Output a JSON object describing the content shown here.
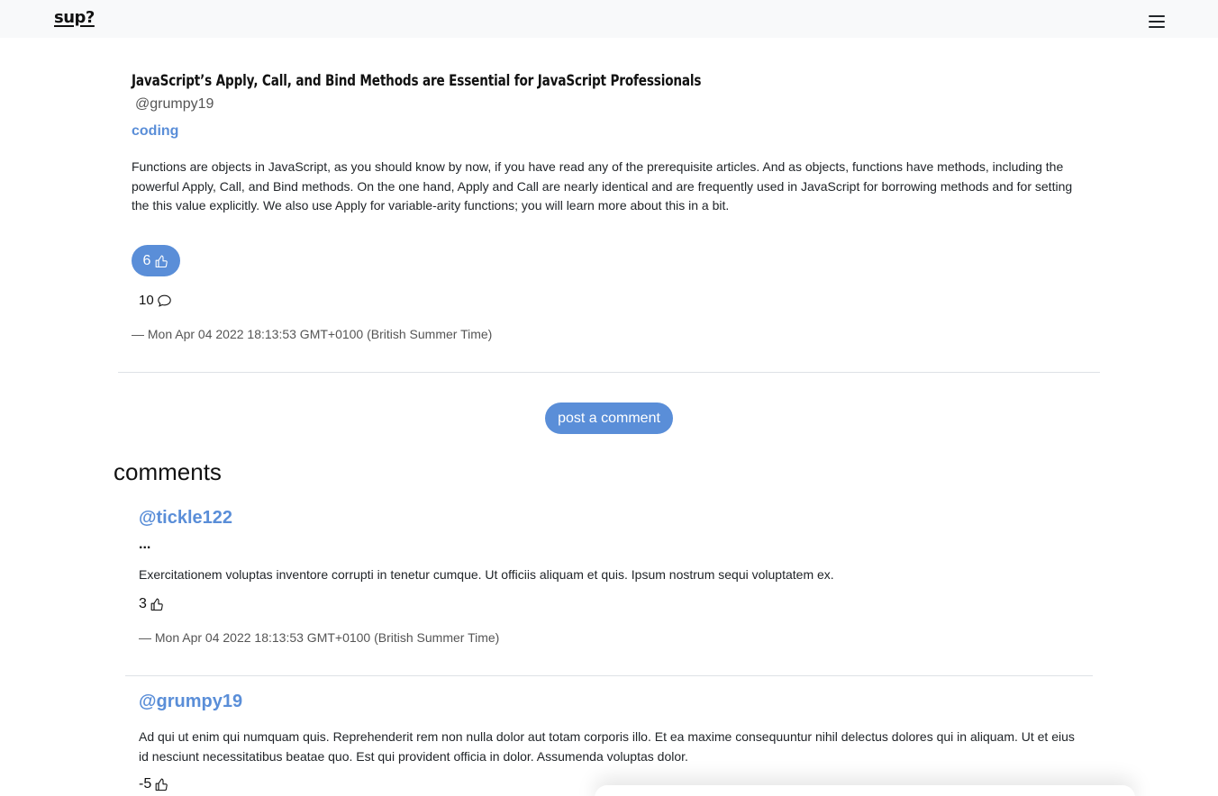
{
  "nav": {
    "brand": "sup?"
  },
  "post": {
    "title": "JavaScript’s Apply, Call, and Bind Methods are Essential for JavaScript Professionals",
    "author": "@grumpy19",
    "tag": "coding",
    "body": "Functions are objects in JavaScript, as you should know by now, if you have read any of the prerequisite articles. And as objects, functions have methods, including the powerful Apply, Call, and Bind methods. On the one hand, Apply and Call are nearly identical and are frequently used in JavaScript for borrowing methods and for setting the this value explicitly. We also use Apply for variable-arity functions; you will learn more about this in a bit.",
    "likes": "6",
    "comment_count": "10",
    "date": "— Mon Apr 04 2022 18:13:53 GMT+0100 (British Summer Time)"
  },
  "actions": {
    "post_comment_label": "post a comment"
  },
  "comments_heading": "comments",
  "comments": [
    {
      "author": "@tickle122",
      "menu": "...",
      "body": "Exercitationem voluptas inventore corrupti in tenetur cumque. Ut officiis aliquam et quis. Ipsum nostrum sequi voluptatem ex.",
      "likes": "3",
      "date": "— Mon Apr 04 2022 18:13:53 GMT+0100 (British Summer Time)"
    },
    {
      "author": "@grumpy19",
      "body": "Ad qui ut enim qui numquam quis. Reprehenderit rem non nulla dolor aut totam corporis illo. Et ea maxime consequuntur nihil delectus dolores qui in aliquam. Ut et eius id nesciunt necessitatibus beatae quo. Est qui provident officia in dolor. Assumenda voluptas dolor.",
      "likes": "-5"
    }
  ],
  "icons": {
    "like": "thumbs-up-icon",
    "comment": "speech-bubble-icon",
    "menu": "hamburger-icon"
  },
  "colors": {
    "accent": "#5a8ed8",
    "navbar_bg": "#f8f9fa"
  }
}
